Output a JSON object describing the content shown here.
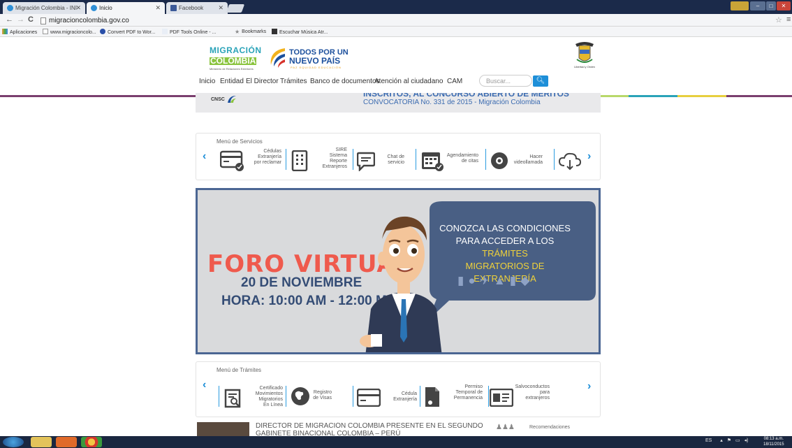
{
  "browser": {
    "tabs": [
      {
        "label": "Migración Colombia - INI"
      },
      {
        "label": "Inicio"
      },
      {
        "label": "Facebook"
      }
    ],
    "url": "migracioncolombia.gov.co",
    "bookmarks": [
      {
        "label": "Aplicaciones"
      },
      {
        "label": "www.migracioncolo..."
      },
      {
        "label": "Convert PDF to Wor..."
      },
      {
        "label": "PDF Tools Online - ..."
      },
      {
        "label": "Bookmarks"
      },
      {
        "label": "Escuchar Música Atr..."
      }
    ]
  },
  "header": {
    "logo_migracion": {
      "line1": "MIGRACIÓN",
      "line2": "COLOMBIA",
      "line3": "Ministerio de Relaciones Exteriores"
    },
    "logo_todos": {
      "line1": "TODOS POR UN",
      "line2": "NUEVO PAÍS",
      "line3": "PAZ  EQUIDAD  EDUCACIÓN"
    },
    "escudo_caption": "Libertad y Orden",
    "nav": [
      "Inicio",
      "Entidad",
      "El Director",
      "Trámites",
      "Banco de documentos",
      "Atención al ciudadano",
      "CAM"
    ],
    "search_placeholder": "Buscar...",
    "strip_colors": [
      "#7a3e6e",
      "#b8d86a",
      "#2aa3b8",
      "#e7cf3e",
      "#7a3e6e"
    ]
  },
  "convocatoria": {
    "title": "INSCRITOS, AL CONCURSO ABIERTO DE MÉRITOS",
    "subtitle": "CONVOCATORIA No. 331 de 2015 - Migración Colombia",
    "logo": "CNSC"
  },
  "servicios": {
    "title": "Menú de Servicios",
    "items": [
      {
        "label": "Cédulas\nExtranjería\npor reclamar",
        "icon": "id-card-icon"
      },
      {
        "label": "SIRE\nSistema\nReporte\nExtranjeros",
        "icon": "building-icon"
      },
      {
        "label": "Chat de\nservicio",
        "icon": "chat-icon"
      },
      {
        "label": "Agendamiento\nde citas",
        "icon": "calendar-icon"
      },
      {
        "label": "Hacer\nvideollamada",
        "icon": "webcam-icon"
      },
      {
        "label": "",
        "icon": "cloud-download-icon"
      }
    ]
  },
  "foro": {
    "title": "FORO VIRTUAL",
    "date": "20 DE NOVIEMBRE",
    "hour": "HORA: 10:00 AM - 12:00 M",
    "bubble_line1": "CONOZCA LAS CONDICIONES",
    "bubble_line2a": "PARA ACCEDER A LOS ",
    "bubble_line2b": "TRÁMITES",
    "bubble_line3": "MIGRATORIOS DE EXTRANJERÍA"
  },
  "tramites": {
    "title": "Menú de Trámites",
    "items": [
      {
        "label": "Certificado\nMovimientos\nMigratorios\nEn Línea",
        "icon": "certificate-icon"
      },
      {
        "label": "Registro\nde Visas",
        "icon": "globe-icon"
      },
      {
        "label": "Cédula\nExtranjería",
        "icon": "id-card-icon"
      },
      {
        "label": "Permiso\nTemporal de\nPermanencia",
        "icon": "document-icon"
      },
      {
        "label": "Salvoconductos\npara\nextranjeros",
        "icon": "form-icon"
      }
    ]
  },
  "news": {
    "headline_line1": "DIRECTOR DE MIGRACIÓN COLOMBIA PRESENTE EN EL SEGUNDO",
    "headline_line2": "GABINETE BINACIONAL COLOMBIA – PERÚ",
    "recommendations": "Recomendaciones"
  },
  "taskbar": {
    "lang": "ES",
    "time": "08:13 a.m.",
    "date": "18/11/2015"
  }
}
